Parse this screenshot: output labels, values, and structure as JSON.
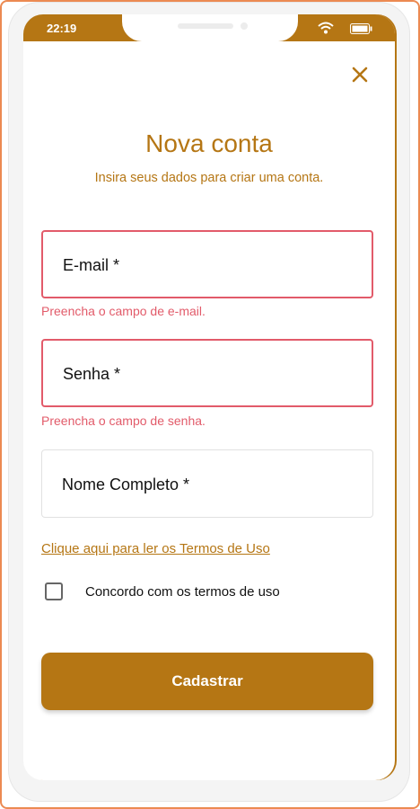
{
  "status_bar": {
    "time": "22:19",
    "wifi_icon": "wifi-icon",
    "battery_icon": "battery-icon"
  },
  "header": {
    "close_icon": "close-icon",
    "title": "Nova conta",
    "subtitle": "Insira seus dados para criar uma conta."
  },
  "form": {
    "email": {
      "placeholder": "E-mail *",
      "value": "",
      "error": "Preencha o campo de e-mail."
    },
    "password": {
      "placeholder": "Senha *",
      "value": "",
      "error": "Preencha o campo de senha."
    },
    "full_name": {
      "placeholder": "Nome Completo *",
      "value": ""
    },
    "terms_link": "Clique aqui para ler os Termos de Uso",
    "agree_label": "Concordo com os termos de uso",
    "agree_checked": false,
    "submit_label": "Cadastrar"
  },
  "colors": {
    "accent": "#b57614",
    "error": "#e25b6a",
    "frame_border": "#ec8a52"
  }
}
